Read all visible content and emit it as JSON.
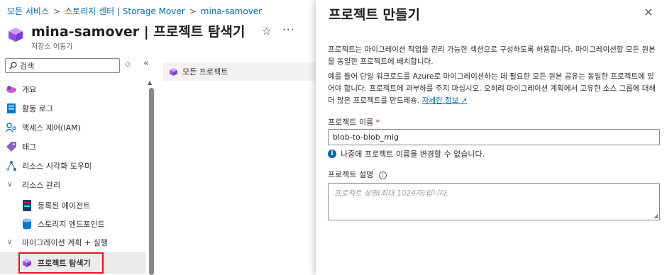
{
  "breadcrumb": [
    "모든 서비스",
    "스토리지 센터 | Storage Mover",
    "mina-samover"
  ],
  "resource": {
    "title": "mina-samover | 프로젝트 탐색기",
    "subtitle": "저장소 이동기",
    "star_icon": "star-icon",
    "more_label": "···"
  },
  "search": {
    "placeholder": "검색"
  },
  "nav": {
    "items": [
      {
        "label": "개요",
        "icon": "overview-icon"
      },
      {
        "label": "활동 로그",
        "icon": "activity-log-icon"
      },
      {
        "label": "액세스 제어(IAM)",
        "icon": "iam-icon"
      },
      {
        "label": "태그",
        "icon": "tag-icon"
      },
      {
        "label": "리소스 시각화 도우미",
        "icon": "resource-visualizer-icon"
      },
      {
        "label": "리소스 관리",
        "icon": "chevron-down-icon"
      },
      {
        "label": "등록된 에이전트",
        "icon": "agent-icon"
      },
      {
        "label": "스토리지 엔드포인트",
        "icon": "storage-endpoint-icon"
      },
      {
        "label": "마이그레이션 계획 + 실행",
        "icon": "chevron-down-icon"
      },
      {
        "label": "프로젝트 탐색기",
        "icon": "project-icon"
      }
    ]
  },
  "main": {
    "all_projects": "모든 프로젝트"
  },
  "pane": {
    "title": "프로젝트 만들기",
    "desc1": "프로젝트는 마이그레이션 작업을 관리 가능한 섹션으로 구성하도록 허용합니다. 마이그레이션할 모든 원본을 동일한 프로젝트에 배치합니다.",
    "desc2": "예를 들어 단일 워크로드를 Azure로 마이그레이션하는 데 필요한 모든 원본 공유는 동일한 프로젝트에 있어야 합니다. 프로젝트에 과부하를 주지 마십시오. 오히려 마이그레이션 계획에서 고유한 소스 그룹에 대해 더 많은 프로젝트를 만드레숑.",
    "learn_more": "자세한 정보",
    "name_label": "프로젝트 이름",
    "required_mark": "*",
    "name_value": "blob-to-blob_mig",
    "name_info": "나중에 프로젝트 이름을 변경할 수 없습니다.",
    "desc_label": "프로젝트 설명",
    "desc_placeholder": "프로젝트 설명(최대 1024자)입니다."
  },
  "colors": {
    "accent": "#0067b8",
    "highlight_border": "#e81123",
    "selected_bg": "#edebe9"
  }
}
